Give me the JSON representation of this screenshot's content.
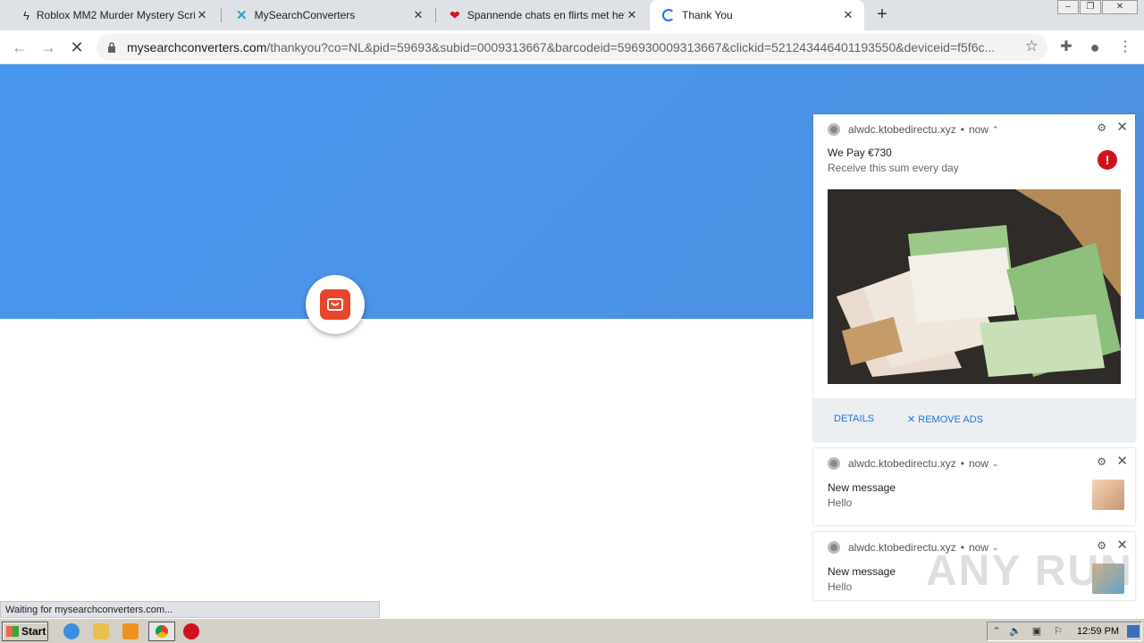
{
  "tabs": [
    {
      "title": "Roblox MM2 Murder Mystery Script C",
      "icon": "lightning-icon"
    },
    {
      "title": "MySearchConverters",
      "icon": "mysearch-logo-icon"
    },
    {
      "title": "Spannende chats en flirts met hete c",
      "icon": "heart-icon"
    },
    {
      "title": "Thank You",
      "icon": "loading-spinner-icon"
    }
  ],
  "address": {
    "host": "mysearchconverters.com",
    "path": "/thankyou?co=NL&pid=59693&subid=0009313667&barcodeid=596930009313667&clickid=521243446401193550&deviceid=f5f6c..."
  },
  "notifications": [
    {
      "source": "alwdc.ktobedirectu.xyz",
      "time": "now",
      "title": "We Pay €730",
      "body": "Receive this sum every day",
      "actions": [
        "DETAILS",
        "REMOVE ADS"
      ]
    },
    {
      "source": "alwdc.ktobedirectu.xyz",
      "time": "now",
      "title": "New message",
      "body": "Hello"
    },
    {
      "source": "alwdc.ktobedirectu.xyz",
      "time": "now",
      "title": "New message",
      "body": "Hello"
    }
  ],
  "status_text": "Waiting for mysearchconverters.com...",
  "watermark": "ANY RUN",
  "taskbar": {
    "start_label": "Start",
    "clock": "12:59 PM"
  },
  "colors": {
    "banner": "#4a97f0",
    "bag": "#e8462a",
    "alert": "#d0121f",
    "link": "#1a73e8"
  }
}
